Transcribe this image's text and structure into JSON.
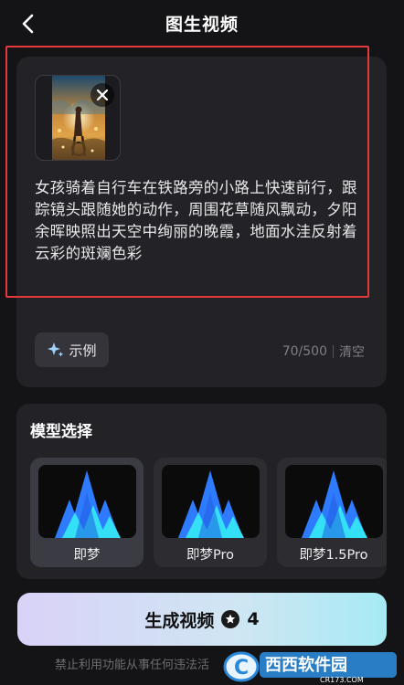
{
  "header": {
    "title": "图生视频"
  },
  "prompt": {
    "text": "女孩骑着自行车在铁路旁的小路上快速前行，跟踪镜头跟随她的动作，周围花草随风飘动，夕阳余晖映照出天空中绚丽的晚霞，地面水洼反射着云彩的斑斓色彩",
    "example_label": "示例",
    "count": "70/500",
    "clear_label": "清空"
  },
  "models": {
    "title": "模型选择",
    "options": [
      {
        "name": "即梦"
      },
      {
        "name": "即梦Pro"
      },
      {
        "name": "即梦1.5Pro"
      }
    ],
    "selected": "即梦"
  },
  "generate": {
    "label": "生成视频",
    "cost": "4"
  },
  "footer": {
    "note": "禁止利用功能从事任何违法活"
  },
  "watermark": {
    "text": "西西软件园",
    "sub": "CR173.COM"
  },
  "icons": {
    "back": "chevron-left-icon",
    "close": "close-icon",
    "sparkle": "sparkle-icon",
    "credit": "star-coin-icon"
  },
  "colors": {
    "background": "#141416",
    "card": "#232327",
    "annotation": "#e23a3a",
    "logo_blue": "#2f7bff",
    "logo_cyan": "#33e0f5"
  }
}
